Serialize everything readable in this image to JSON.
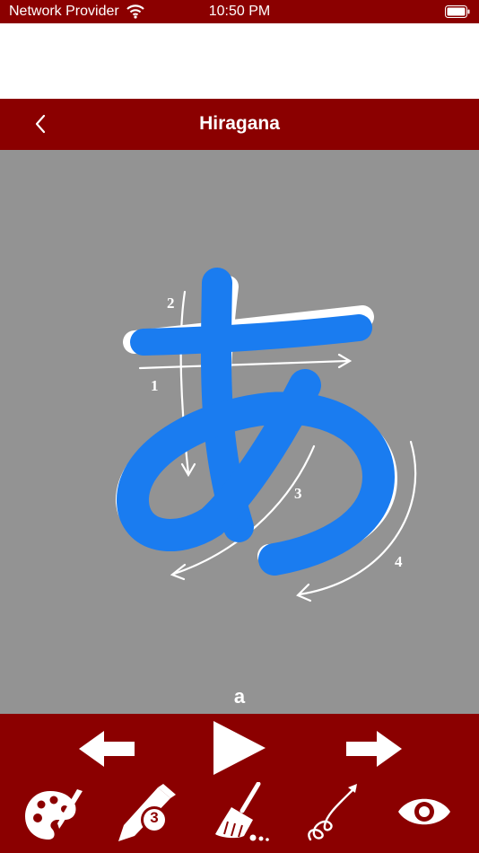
{
  "status_bar": {
    "carrier": "Network Provider",
    "time": "10:50 PM"
  },
  "nav": {
    "title": "Hiragana"
  },
  "character": {
    "glyph": "あ",
    "romaji": "a",
    "stroke_numbers": [
      "1",
      "2",
      "3",
      "4"
    ]
  },
  "tools": {
    "stroke_count_badge": "3"
  },
  "colors": {
    "brand": "#8b0000",
    "canvas": "#939393",
    "user_stroke": "#1a7cf0"
  },
  "icons": [
    "wifi-icon",
    "battery-icon",
    "back-chevron-icon",
    "previous-arrow-icon",
    "play-icon",
    "next-arrow-icon",
    "palette-icon",
    "pencil-icon",
    "eraser-broom-icon",
    "stroke-order-icon",
    "eye-icon"
  ]
}
